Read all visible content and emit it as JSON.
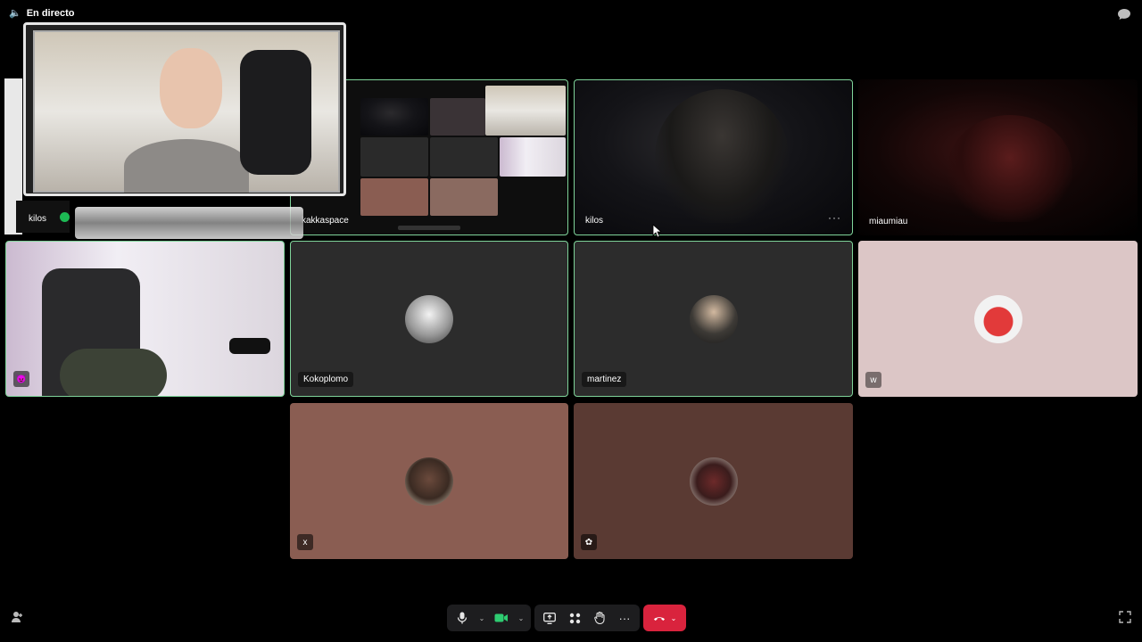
{
  "status": {
    "live_label": "En directo"
  },
  "tiles": {
    "screen_share": {
      "name": "kakkaspace"
    },
    "kilos": {
      "name": "kilos"
    },
    "miaumiau": {
      "name": "miaumiau"
    },
    "overlay_cam": {
      "name": "kilos"
    },
    "red_icon_user": {
      "badge": "😈"
    },
    "kokoplomo": {
      "name": "Kokoplomo"
    },
    "martinez": {
      "name": "martinez"
    },
    "w_user": {
      "badge": "w"
    },
    "x_user": {
      "badge": "x"
    },
    "flower_user": {
      "badge": "✿"
    }
  },
  "tile_menu_label": "···",
  "colors": {
    "speaking_border": "#7fd49a",
    "hangup": "#d9233d",
    "tile_gray": "#2c2c2c",
    "tile_pink": "#dcc6c6",
    "tile_brown": "#8a5d52",
    "tile_dark_brown": "#5a3a33"
  },
  "controls": {
    "mic": "mic-icon",
    "camera": "camera-icon",
    "share": "share-screen-icon",
    "reactions": "grid-icon",
    "raise_hand": "hand-icon",
    "more": "···",
    "hangup": "phone-hangup-icon"
  }
}
